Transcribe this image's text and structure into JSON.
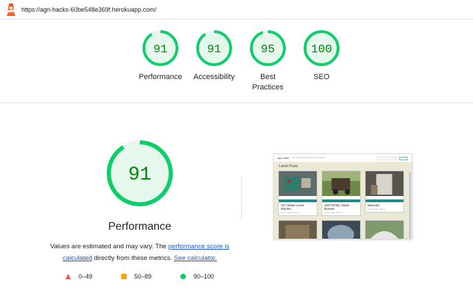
{
  "topbar": {
    "logo_icon": "lighthouse-icon",
    "url": "https://agri-hacks-60be548e369f.herokuapp.com/"
  },
  "colors": {
    "pass": "#0cce6b",
    "pass_text": "#008800",
    "pass_fill": "#e6f7ee",
    "average": "#ffa400",
    "fail": "#ff4e42"
  },
  "categories": [
    {
      "score": 91,
      "label": "Performance"
    },
    {
      "score": 91,
      "label": "Accessibility"
    },
    {
      "score": 95,
      "label": "Best Practices",
      "label_line1": "Best",
      "label_line2": "Practices"
    },
    {
      "score": 100,
      "label": "SEO"
    }
  ],
  "performance": {
    "score": 91,
    "title": "Performance",
    "desc_prefix": "Values are estimated and may vary. The ",
    "desc_link1": "performance score is calculated",
    "desc_middle": " directly from these metrics. ",
    "desc_link2": "See calculator."
  },
  "legend": [
    {
      "shape": "triangle",
      "range": "0–49"
    },
    {
      "shape": "square",
      "range": "50–89"
    },
    {
      "shape": "circle",
      "range": "90–100"
    }
  ],
  "screenshot": {
    "brand": "Agri Hacks",
    "nav": "Home  Post Idea  Categories  Admin  Account",
    "heading": "Latest Posts",
    "cards": [
      {
        "title": "Oil / Water Level Monitor",
        "meta": "Feb. 21, 2024, 3:02 p.m."
      },
      {
        "title": "Self Fill IBC Water Bowser",
        "meta": "Feb. 21, 2024, 3:00 p.m."
      },
      {
        "title": "Meal Bin",
        "meta": "Feb. 21, 2024, 2:59 p.m."
      }
    ]
  }
}
